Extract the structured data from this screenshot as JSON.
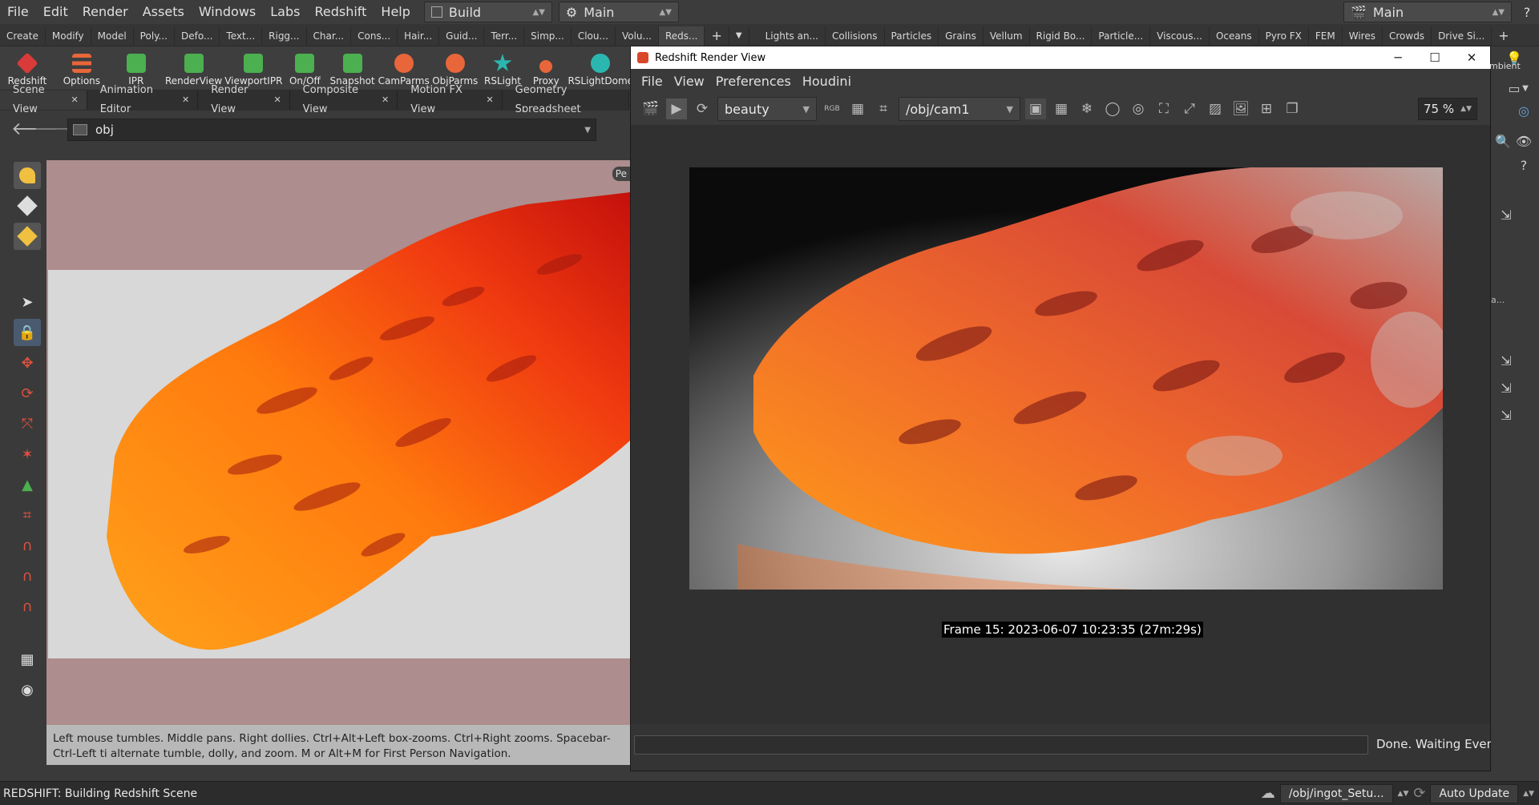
{
  "menubar": {
    "items": [
      "File",
      "Edit",
      "Render",
      "Assets",
      "Windows",
      "Labs",
      "Redshift",
      "Help"
    ],
    "desk_build": "Build",
    "desk_main": "Main",
    "desk_right": "Main"
  },
  "shelf_tabs_left": [
    "Create",
    "Modify",
    "Model",
    "Poly...",
    "Defo...",
    "Text...",
    "Rigg...",
    "Char...",
    "Cons...",
    "Hair...",
    "Guid...",
    "Terr...",
    "Simp...",
    "Clou...",
    "Volu...",
    "Reds..."
  ],
  "shelf_tabs_right": [
    "Lights an...",
    "Collisions",
    "Particles",
    "Grains",
    "Vellum",
    "Rigid Bo...",
    "Particle...",
    "Viscous...",
    "Oceans",
    "Pyro FX",
    "FEM",
    "Wires",
    "Crowds",
    "Drive Si..."
  ],
  "shelf_tools": [
    {
      "label": "Redshift",
      "icon": "redshift-cube-icon",
      "color": "#d93a3a"
    },
    {
      "label": "Options",
      "icon": "options-icon",
      "color": "#e8663a"
    },
    {
      "label": "IPR",
      "icon": "ipr-icon",
      "color": "#4caf50"
    },
    {
      "label": "RenderView",
      "icon": "renderview-icon",
      "color": "#4caf50"
    },
    {
      "label": "ViewportIPR",
      "icon": "viewport-ipr-icon",
      "color": "#4caf50"
    },
    {
      "label": "On/Off",
      "icon": "onoff-icon",
      "color": "#4caf50"
    },
    {
      "label": "Snapshot",
      "icon": "snapshot-icon",
      "color": "#4caf50"
    },
    {
      "label": "CamParms",
      "icon": "camparms-icon",
      "color": "#e8663a"
    },
    {
      "label": "ObjParms",
      "icon": "objparms-icon",
      "color": "#e8663a"
    },
    {
      "label": "RSLight",
      "icon": "rslight-icon",
      "color": "#2bb7b0"
    },
    {
      "label": "Proxy",
      "icon": "proxy-icon",
      "color": "#e8663a"
    },
    {
      "label": "RSLightDome",
      "icon": "lightdome-icon",
      "color": "#2bb7b0"
    }
  ],
  "pane_tabs": [
    "Scene View",
    "Animation Editor",
    "Render View",
    "Composite View",
    "Motion FX View",
    "Geometry Spreadsheet"
  ],
  "path_field": "obj",
  "viewport_help": "Left mouse tumbles. Middle pans. Right dollies. Ctrl+Alt+Left box-zooms. Ctrl+Right zooms. Spacebar-Ctrl-Left ti alternate tumble, dolly, and zoom.     M or Alt+M for First Person Navigation.",
  "viewport_corner_label": "Pe",
  "render_view": {
    "title": "Redshift Render View",
    "menu": [
      "File",
      "View",
      "Preferences",
      "Houdini"
    ],
    "aov": "beauty",
    "camera": "/obj/cam1",
    "zoom": "75 %",
    "frame_info": "Frame  15:  2023-06-07  10:23:35  (27m:29s)",
    "status": "Done. Waiting Events",
    "progress": 0
  },
  "right_panel_labels": {
    "ambient": "mbient",
    "dots": "a..."
  },
  "statusbar": {
    "message": "REDSHIFT: Building Redshift Scene",
    "path": "/obj/ingot_Setu...",
    "update_mode": "Auto Update"
  },
  "colors": {
    "accent_orange": "#ff8c1a",
    "render_red": "#d94a2a",
    "redshift_red": "#d93a3a"
  }
}
